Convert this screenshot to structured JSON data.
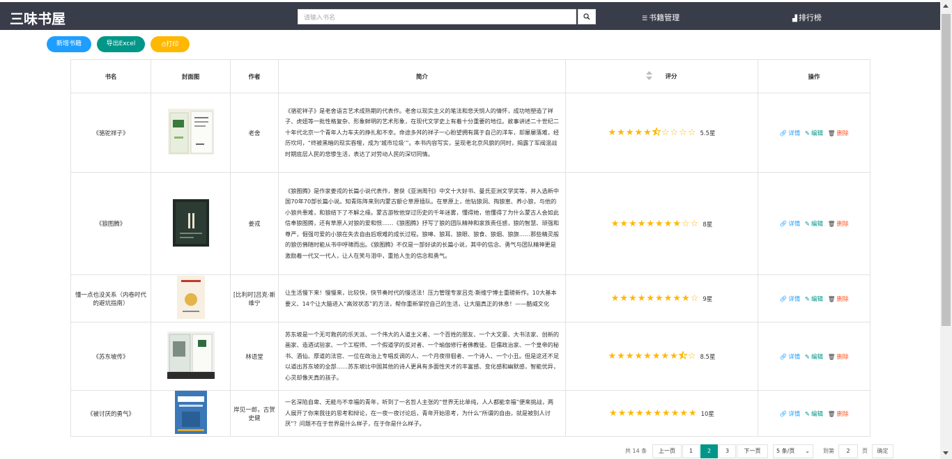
{
  "header": {
    "logo": "三味书屋",
    "search_placeholder": "请输入书名",
    "nav": [
      {
        "icon": "list-icon",
        "label": "书籍管理"
      },
      {
        "icon": "bar-chart-icon",
        "label": "排行榜"
      }
    ]
  },
  "toolbar": {
    "add_label": "新增书籍",
    "export_label": "导出Excel",
    "print_label": "打印",
    "colors": {
      "add": "#1e9fff",
      "export": "#009688",
      "print": "#ffb800"
    }
  },
  "table": {
    "headers": [
      "书名",
      "封面图",
      "作者",
      "简介",
      "评分",
      "操作"
    ],
    "rows": [
      {
        "title": "《骆驼祥子》",
        "author": "老舍",
        "intro": "《骆驼祥子》是老舍语言艺术成熟期的代表作。老舍以现实主义的笔法和悲天悯人的情怀，成功地塑造了祥子、虎妞等一批性格复杂、形象鲜明的艺术形象，在现代文学史上有着十分重要的地位。故事讲述二十世纪二十年代北京一个青年人力车夫的挣扎和不幸。命途多舛的祥子一心盼望拥有属于自己的洋车，却屡屡落难，经历坎坷，“终被黑暗的现实吞噬，成为‘城市垃圾’”。本书内容写实，呈现老北京风貌的同时，揭露了军阀混战时期底层人民的悲惨生活，表达了对劳动人民的深切同情。",
        "rating": 5.5,
        "score_label": "5.5星"
      },
      {
        "title": "《狼图腾》",
        "author": "姜戎",
        "intro": "《狼图腾》是作家姜戎的长篇小说代表作，曾获《亚洲周刊》中文十大好书、曼氏亚洲文学奖等，并入选新中国70年70部长篇小说。知青陈阵来到内蒙古额仑草原插队。在草原上，他钻狼洞、掏狼崽、养小狼，与他的小狼共患难，和狼结下了不解之缘。蒙古游牧他穿过历史的千年迷雾，懂得她，他懂得了为什么蒙古人会如此信奉狼图腾，还有草原人对狼的爱和恨……《狼图腾》抒写了狼的团队精神和家族责任感，狼的智慧、顽强和尊严，倔强可爱的小狼在失去自由后艰难的成长过程。狼嗥、狼耳、狼眼、狼食、狼烟、狼旗……那些精灵般的狼仿佛随时能从书中呼啸而出。《狼图腾》不仅是一部好读的长篇小说，其中的信念、勇气与团队精神更是激励着一代又一代人，让人在笑与泪中，重拾人生的信念和勇气。",
        "rating": 8,
        "score_label": "8星"
      },
      {
        "title": "懂一点也没关系（内卷时代的避坑指南）",
        "author": "[比利时]吕克·斯维宁",
        "intro": "让生活慢下来！慢慢来，比较快，快节奏时代的慢活法！压力管理专家吕克·斯维宁博士重磅新作。10大基本要义、14个让大脑进入“高效状态”的方法，帮你重新掌控自己的生活，让大脑真正的休息！——酷威文化",
        "rating": 9,
        "score_label": "9星"
      },
      {
        "title": "《苏东坡传》",
        "author": "林语堂",
        "intro": "苏东坡是一个无可救药的乐天派、一个伟大的人道主义者、一个百姓的朋友、一个大文豪、大书法家、创新的画家、造酒试验家、一个工程师、一个假道学的反对者、一个瑜伽修行者佛教徒、巨儒政治家、一个皇帝的秘书、酒仙、厚道的法官、一位在政治上专唱反调的人、一个月夜徘徊者、一个诗人、一个小丑。但是这还不足以道出苏东坡的全部……苏东坡比中国其他的诗人更具有多面性天才的丰富感、变化感和幽默感，智能优异，心灵却像天真的孩子。",
        "rating": 8.5,
        "score_label": "8.5星"
      },
      {
        "title": "《被讨厌的勇气》",
        "author": "岸见一郎，古贺史健",
        "intro": "一名深陷自卑、无能与不幸福的青年，听到了一名哲人主张的“世界无比单纯，人人都能幸福”便来挑战，两人展开了你来我往的思考和辩论，在一夜一夜讨论后，青年开始思考，为什么“所谓的自由，就是被别人讨厌”？问题不在于世界是什么样子，在于你是什么样子。",
        "rating": 10,
        "score_label": "10星"
      }
    ],
    "ops": {
      "detail": "详情",
      "edit": "编辑",
      "del": "删除"
    }
  },
  "pager": {
    "total_label": "共 14 条",
    "prev": "上一页",
    "pages": [
      "1",
      "2",
      "3"
    ],
    "current": "2",
    "next": "下一页",
    "per_page": "5 条/页",
    "goto_label": "到第",
    "goto_value": "2",
    "page_unit": "页",
    "confirm": "确定"
  }
}
